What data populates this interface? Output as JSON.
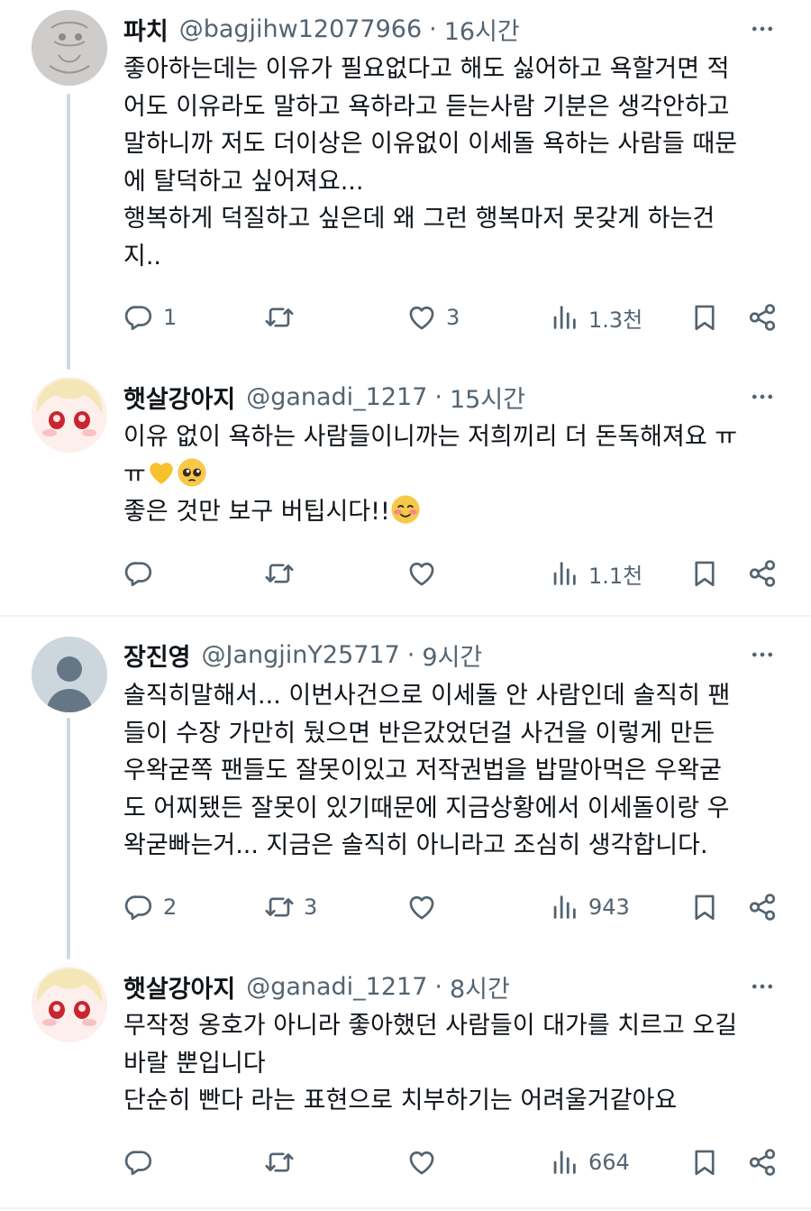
{
  "tweets": [
    {
      "name": "파치",
      "handle": "@bagjihw12077966",
      "separator": "·",
      "time": "16시간",
      "lines": [
        "좋아하는데는 이유가 필요없다고 해도 싫어하고 욕할거면 적",
        "어도 이유라도 말하고 욕하라고 듣는사람 기분은 생각안하고",
        "말하니까 저도 더이상은 이유없이 이세돌 욕하는 사람들 때문",
        "에 탈덕하고 싶어져요...",
        "행복하게 덕질하고 싶은데 왜 그런 행복마저 못갖게 하는건",
        "지.."
      ],
      "replies": "1",
      "retweets": "",
      "likes": "3",
      "views": "1.3천"
    },
    {
      "name": "햇살강아지",
      "handle": "@ganadi_1217",
      "separator": "·",
      "time": "15시간",
      "line1": "이유 없이 욕하는 사람들이니까는 저희끼리 더 돈독해져요 ㅠ",
      "line2": "ㅠ",
      "line3": "좋은 것만 보구 버팁시다!!",
      "emojis": [
        "yellow-heart",
        "pleading-face",
        "smiling-face"
      ],
      "replies": "",
      "retweets": "",
      "likes": "",
      "views": "1.1천"
    },
    {
      "name": "장진영",
      "handle": "@JangjinY25717",
      "separator": "·",
      "time": "9시간",
      "lines": [
        "솔직히말해서... 이번사건으로 이세돌 안 사람인데 솔직히 팬",
        "들이 수장 가만히 뒀으면 반은갔었던걸 사건을 이렇게 만든",
        "우왁굳쪽 팬들도 잘못이있고 저작권법을 밥말아먹은 우왁굳",
        "도 어찌됐든 잘못이 있기때문에 지금상황에서 이세돌이랑 우",
        "왁굳빠는거... 지금은 솔직히 아니라고 조심히 생각합니다."
      ],
      "replies": "2",
      "retweets": "3",
      "likes": "",
      "views": "943"
    },
    {
      "name": "햇살강아지",
      "handle": "@ganadi_1217",
      "separator": "·",
      "time": "8시간",
      "lines": [
        "무작정 옹호가 아니라 좋아했던 사람들이 대가를 치르고 오길",
        "바랄 뿐입니다",
        "단순히 빤다 라는 표현으로 치부하기는 어려울거같아요"
      ],
      "replies": "",
      "retweets": "",
      "likes": "",
      "views": "664"
    }
  ],
  "colors": {
    "text": "#0f1419",
    "secondary": "#536471",
    "thread_line": "#cfd9de",
    "divider": "#eff3f4"
  },
  "icons": [
    "reply-icon",
    "retweet-icon",
    "like-icon",
    "views-icon",
    "bookmark-icon",
    "share-icon",
    "more-icon"
  ]
}
